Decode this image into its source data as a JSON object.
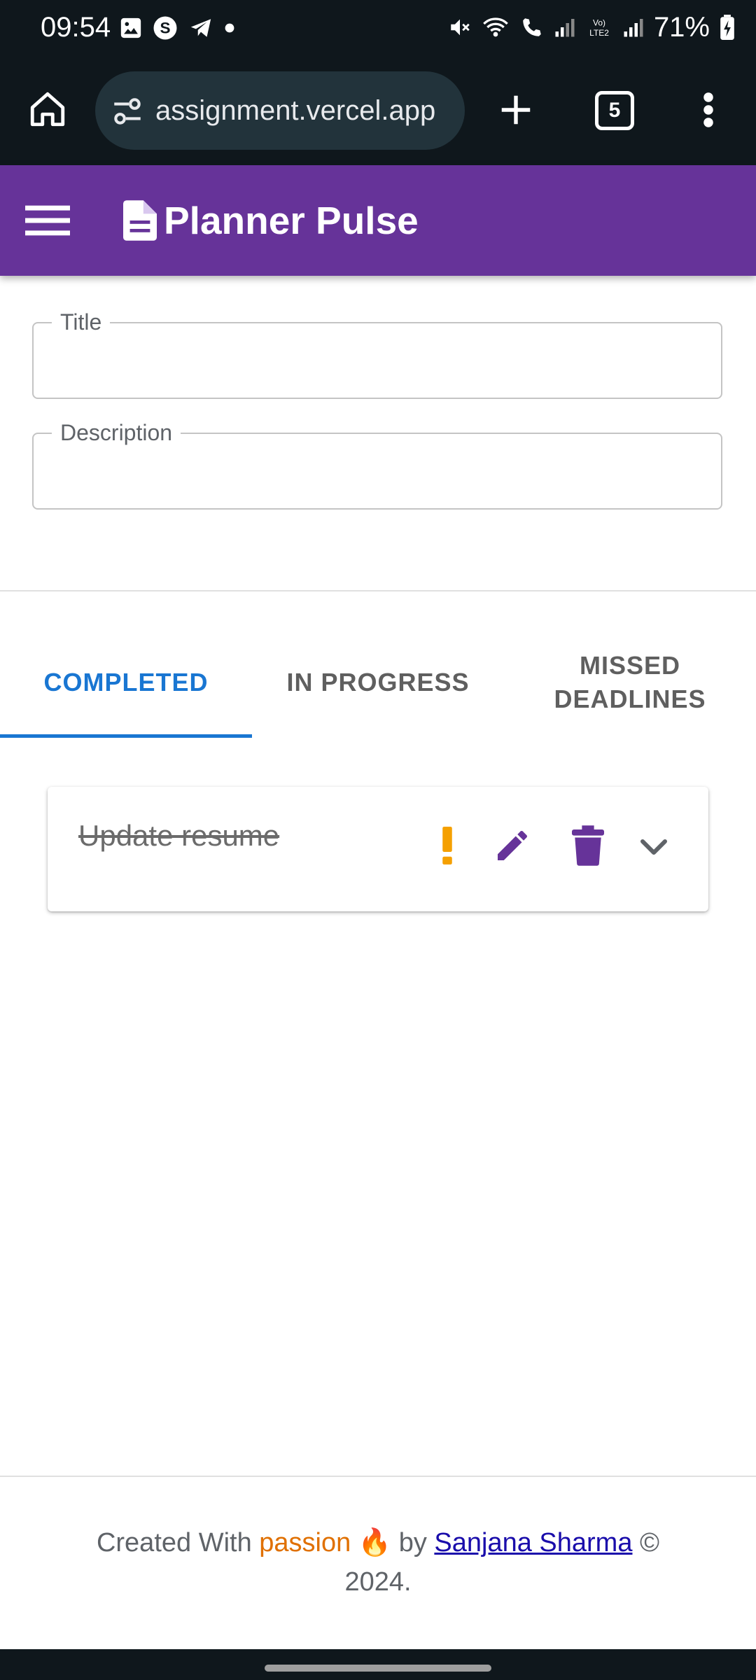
{
  "status_bar": {
    "time": "09:54",
    "battery": "71%",
    "left_icons": [
      "gallery-icon",
      "s-app-icon",
      "telegram-icon",
      "dot-icon"
    ],
    "right_icons": [
      "mute-icon",
      "wifi-icon",
      "wifi-call-icon",
      "signal-icon",
      "volte-icon",
      "signal-icon",
      "battery-icon"
    ]
  },
  "browser": {
    "url": "assignment.vercel.app",
    "tab_count": "5"
  },
  "app": {
    "title": "Planner Pulse"
  },
  "form": {
    "title_label": "Title",
    "title_value": "",
    "description_label": "Description",
    "description_value": ""
  },
  "tabs": [
    {
      "label": "COMPLETED",
      "active": true
    },
    {
      "label": "IN PROGRESS",
      "active": false
    },
    {
      "label": "MISSED DEADLINES",
      "active": false
    }
  ],
  "tasks": [
    {
      "title": "Update resume",
      "completed": true,
      "priority_icon": "priority-icon",
      "actions": [
        "edit-icon",
        "delete-icon",
        "expand-icon"
      ]
    }
  ],
  "footer": {
    "prefix": "Created With ",
    "passion": "passion",
    "emoji": "🔥",
    "by": " by ",
    "author": "Sanjana Sharma",
    "suffix": " © 2024."
  },
  "colors": {
    "app_bar": "#663399",
    "accent": "#1976d2",
    "priority": "#f5a000",
    "action": "#663399",
    "passion": "#e07000"
  }
}
